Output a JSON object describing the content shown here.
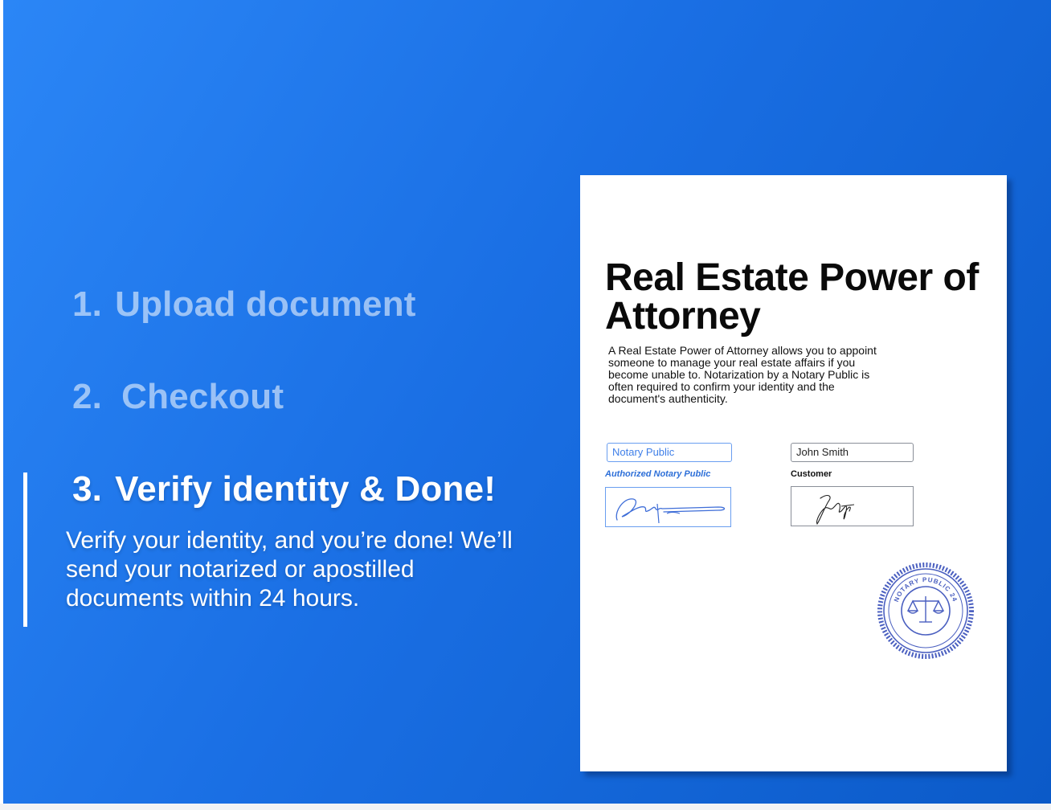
{
  "steps": [
    {
      "number": "1.",
      "label": "Upload document",
      "active": false
    },
    {
      "number": "2.",
      "label": "Checkout",
      "active": false
    },
    {
      "number": "3.",
      "label": "Verify identity & Done!",
      "active": true
    }
  ],
  "active_step_description": "Verify your identity, and you’re done! We’ll send your notarized or apostilled documents within 24 hours.",
  "document": {
    "title": "Real Estate Power of Attorney",
    "body": "A Real Estate Power of Attorney allows you to appoint someone to manage your real estate affairs if you become unable to. Notarization by a Notary Public is often required to confirm your identity and the document's authenticity.",
    "notary_field_value": "Notary Public",
    "notary_role_label": "Authorized Notary Public",
    "customer_field_value": "John Smith",
    "customer_role_label": "Customer",
    "seal_text": "NOTARY PUBLIC 24",
    "seal_icon": "scales-of-justice-icon"
  },
  "colors": {
    "gradient_start": "#2b86f6",
    "gradient_end": "#0b5ac8",
    "notary_accent": "#3f7fe8",
    "seal_color": "#4a5fc0"
  }
}
